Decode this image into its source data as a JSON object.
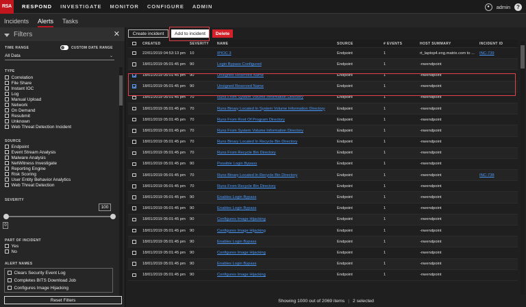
{
  "brand": {
    "logo_text": "RSA",
    "accent": "#c2161e"
  },
  "topnav": {
    "items": [
      "RESPOND",
      "INVESTIGATE",
      "MONITOR",
      "CONFIGURE",
      "ADMIN"
    ],
    "active": "RESPOND",
    "user": "admin",
    "help": "?"
  },
  "subnav": {
    "tabs": [
      "Incidents",
      "Alerts",
      "Tasks"
    ],
    "active": "Alerts"
  },
  "filters": {
    "title": "Filters",
    "time_range": {
      "label": "TIME RANGE",
      "custom_label": "CUSTOM DATE RANGE",
      "value": "All Data"
    },
    "type": {
      "label": "TYPE",
      "options": [
        "Correlation",
        "File Share",
        "Instant IOC",
        "Log",
        "Manual Upload",
        "Network",
        "On Demand",
        "Resubmit",
        "Unknown",
        "Web Threat Detection Incident"
      ]
    },
    "source": {
      "label": "SOURCE",
      "options": [
        "Endpoint",
        "Event Stream Analysis",
        "Malware Analysis",
        "NetWitness Investigate",
        "Reporting Engine",
        "Risk Scoring",
        "User Entity Behavior Analytics",
        "Web Threat Detection"
      ]
    },
    "severity": {
      "label": "SEVERITY",
      "min": "0",
      "max": "100"
    },
    "part_of_incident": {
      "label": "PART OF INCIDENT",
      "options": [
        "Yes",
        "No"
      ]
    },
    "alert_names": {
      "label": "ALERT NAMES",
      "options": [
        "Clears Security Event Log",
        "Completes BITS Download Job",
        "Configures Image Hijacking"
      ]
    },
    "reset_label": "Reset Filters"
  },
  "toolbar": {
    "create_label": "Create incident",
    "add_label": "Add to incident",
    "delete_label": "Delete"
  },
  "table": {
    "headers": [
      "CREATED",
      "SEVERITY",
      "NAME",
      "SOURCE",
      "# EVENTS",
      "HOST SUMMARY",
      "INCIDENT ID"
    ],
    "rows": [
      {
        "created": "22/01/2019 04:53:13 pm",
        "severity": "10",
        "name": "IPIOC 3",
        "source": "Endpoint",
        "events": "1",
        "host": "rt_laptop4.eng.matrix.com to ...",
        "incident": "INC-739",
        "checked": false
      },
      {
        "created": "18/01/2019 05:01:45 pm",
        "severity": "90",
        "name": "Login Bypass Configured",
        "source": "Endpoint",
        "events": "1",
        "host": "-nwendpoint",
        "incident": "",
        "checked": false
      },
      {
        "created": "18/01/2019 05:01:45 pm",
        "severity": "90",
        "name": "Unsigned Reserved Name",
        "source": "Endpoint",
        "events": "1",
        "host": "-nwendpoint",
        "incident": "",
        "checked": true
      },
      {
        "created": "18/01/2019 05:01:45 pm",
        "severity": "90",
        "name": "Unsigned Reserved Name",
        "source": "Endpoint",
        "events": "1",
        "host": "-nwendpoint",
        "incident": "",
        "checked": true
      },
      {
        "created": "18/01/2019 05:01:45 pm",
        "severity": "70",
        "name": "Runs From System Volume Information Directory",
        "source": "Endpoint",
        "events": "1",
        "host": "-nwendpoint",
        "incident": "",
        "checked": false
      },
      {
        "created": "18/01/2019 05:01:45 pm",
        "severity": "70",
        "name": "Runs Binary Located In System Volume Information Directory",
        "source": "Endpoint",
        "events": "1",
        "host": "-nwendpoint",
        "incident": "",
        "checked": false
      },
      {
        "created": "18/01/2019 05:01:45 pm",
        "severity": "70",
        "name": "Runs From Root Of Program Directory",
        "source": "Endpoint",
        "events": "1",
        "host": "-nwendpoint",
        "incident": "",
        "checked": false
      },
      {
        "created": "18/01/2019 05:01:45 pm",
        "severity": "70",
        "name": "Runs From System Volume Information Directory",
        "source": "Endpoint",
        "events": "1",
        "host": "-nwendpoint",
        "incident": "",
        "checked": false
      },
      {
        "created": "18/01/2019 05:01:45 pm",
        "severity": "70",
        "name": "Runs Binary Located In Recycle Bin Directory",
        "source": "Endpoint",
        "events": "1",
        "host": "-nwendpoint",
        "incident": "",
        "checked": false
      },
      {
        "created": "18/01/2019 05:01:45 pm",
        "severity": "70",
        "name": "Runs From Recycle Bin Directory",
        "source": "Endpoint",
        "events": "1",
        "host": "-nwendpoint",
        "incident": "",
        "checked": false
      },
      {
        "created": "18/01/2019 05:01:45 pm",
        "severity": "90",
        "name": "Possible Login Bypass",
        "source": "Endpoint",
        "events": "1",
        "host": "-nwendpoint",
        "incident": "",
        "checked": false
      },
      {
        "created": "18/01/2019 05:01:45 pm",
        "severity": "70",
        "name": "Runs Binary Located In Recycle Bin Directory",
        "source": "Endpoint",
        "events": "1",
        "host": "-nwendpoint",
        "incident": "INC-738",
        "checked": false
      },
      {
        "created": "18/01/2019 05:01:45 pm",
        "severity": "70",
        "name": "Runs From Recycle Bin Directory",
        "source": "Endpoint",
        "events": "1",
        "host": "-nwendpoint",
        "incident": "",
        "checked": false
      },
      {
        "created": "18/01/2019 05:01:45 pm",
        "severity": "90",
        "name": "Enables Login Bypass",
        "source": "Endpoint",
        "events": "1",
        "host": "-nwendpoint",
        "incident": "",
        "checked": false
      },
      {
        "created": "18/01/2019 05:01:45 pm",
        "severity": "90",
        "name": "Enables Login Bypass",
        "source": "Endpoint",
        "events": "1",
        "host": "-nwendpoint",
        "incident": "",
        "checked": false
      },
      {
        "created": "18/01/2019 05:01:45 pm",
        "severity": "90",
        "name": "Configures Image Hijacking",
        "source": "Endpoint",
        "events": "1",
        "host": "-nwendpoint",
        "incident": "",
        "checked": false
      },
      {
        "created": "18/01/2019 05:01:45 pm",
        "severity": "90",
        "name": "Configures Image Hijacking",
        "source": "Endpoint",
        "events": "1",
        "host": "-nwendpoint",
        "incident": "",
        "checked": false
      },
      {
        "created": "18/01/2019 05:01:45 pm",
        "severity": "90",
        "name": "Enables Login Bypass",
        "source": "Endpoint",
        "events": "1",
        "host": "-nwendpoint",
        "incident": "",
        "checked": false
      },
      {
        "created": "18/01/2019 05:01:45 pm",
        "severity": "90",
        "name": "Configures Image Hijacking",
        "source": "Endpoint",
        "events": "1",
        "host": "-nwendpoint",
        "incident": "",
        "checked": false
      },
      {
        "created": "18/01/2019 05:01:45 pm",
        "severity": "90",
        "name": "Enables Login Bypass",
        "source": "Endpoint",
        "events": "1",
        "host": "-nwendpoint",
        "incident": "",
        "checked": false
      },
      {
        "created": "18/01/2019 05:01:45 pm",
        "severity": "90",
        "name": "Configures Image Hijacking",
        "source": "Endpoint",
        "events": "1",
        "host": "-nwendpoint",
        "incident": "",
        "checked": false
      }
    ]
  },
  "footer": {
    "showing": "Showing 1000 out of 2069 items",
    "selected": "2 selected"
  }
}
